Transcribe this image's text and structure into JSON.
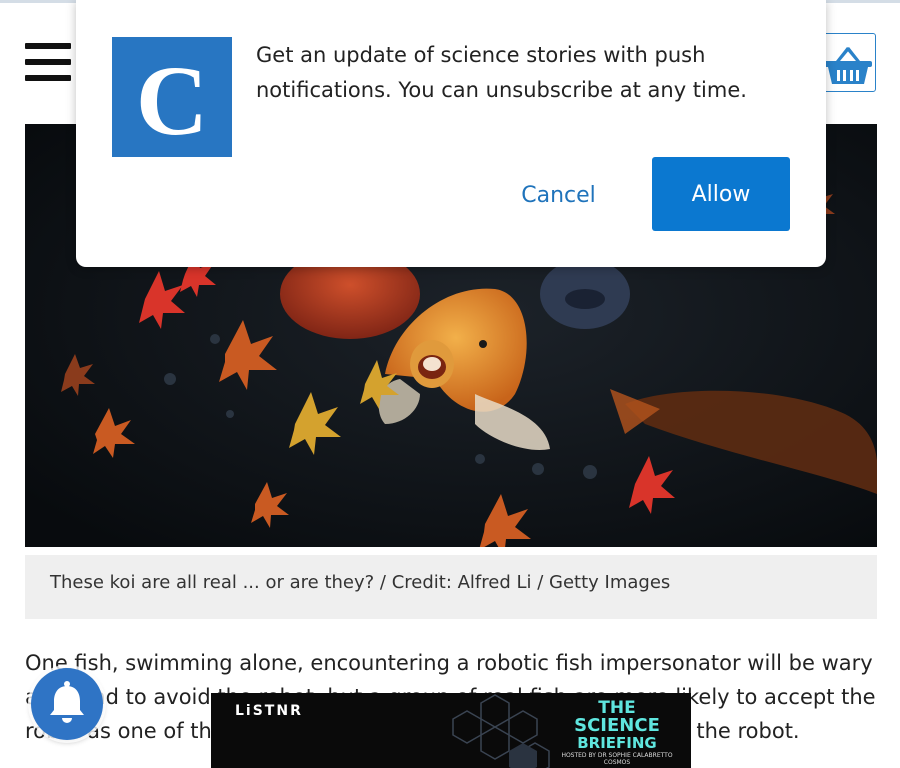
{
  "header": {
    "menu_icon": "hamburger-menu-icon",
    "cart_icon": "shopping-basket-icon"
  },
  "hero": {
    "caption": "These koi are all real ... or are they? / Credit: Alfred Li / Getty Images"
  },
  "article": {
    "paragraph": "One fish, swimming alone, encountering a robotic fish impersonator will be wary and tend to avoid the robot, but a group of real fish are more likely to accept the robot as one of their own, and even allow the real fish to follow the robot."
  },
  "push_dialog": {
    "logo_letter": "C",
    "message": "Get an update of science stories with push notifications. You can unsubscribe at any time.",
    "cancel_label": "Cancel",
    "allow_label": "Allow"
  },
  "notification_bell": {
    "icon": "bell-icon"
  },
  "ad": {
    "brand": "LiSTNR",
    "title_line1": "THE",
    "title_line2": "SCIENCE",
    "title_line3": "BRIEFING",
    "subline": "HOSTED BY DR SOPHIE CALABRETTO COSMOS"
  },
  "colors": {
    "accent": "#0b78d0",
    "logo_bg": "#2876c2",
    "bell_bg": "#2f74c5",
    "caption_bg": "#efefef"
  }
}
